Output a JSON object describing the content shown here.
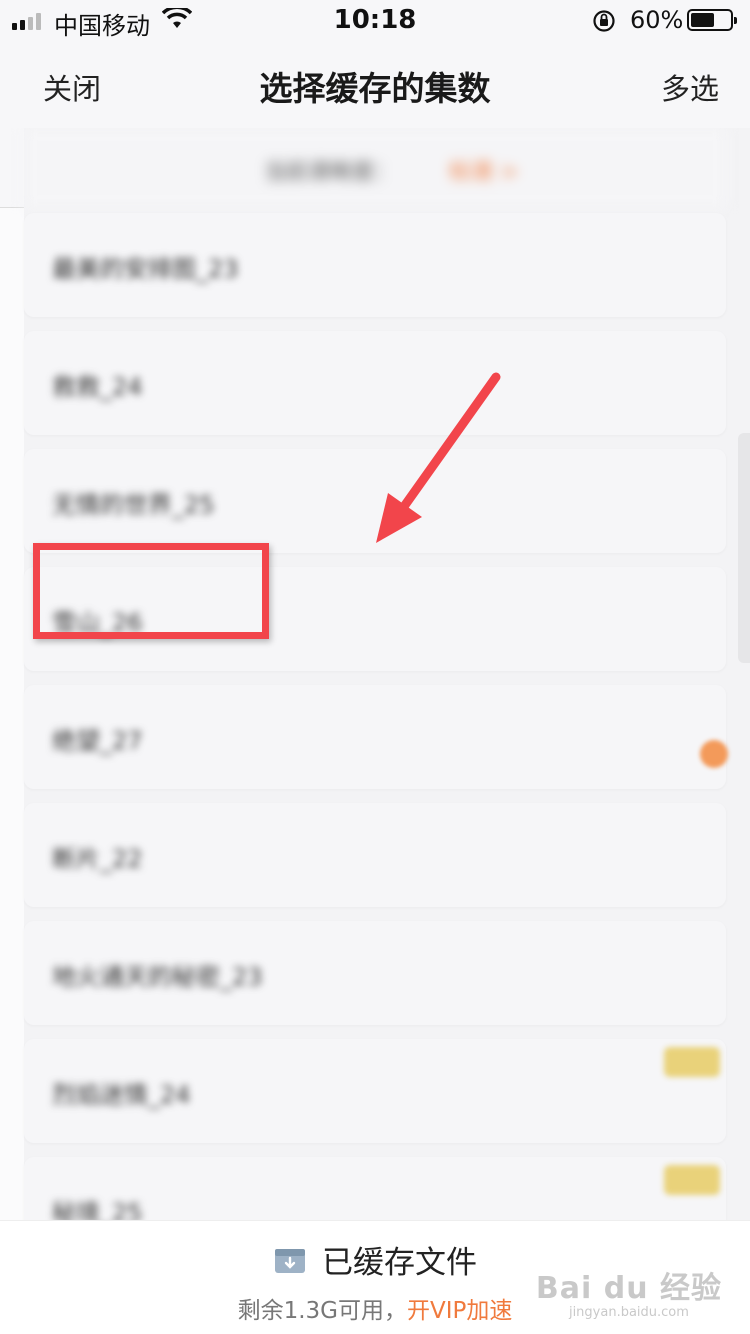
{
  "status_bar": {
    "carrier": "中国移动",
    "time": "10:18",
    "battery_percent": "60%",
    "battery_level": 0.6
  },
  "nav": {
    "close_label": "关闭",
    "title": "选择缓存的集数",
    "multi_select_label": "多选"
  },
  "notice": {
    "text": "当前清晰度：",
    "link": "标清 >"
  },
  "episodes": [
    {
      "label": "最美的安排图_23"
    },
    {
      "label": "救救_24"
    },
    {
      "label": "无情的世界_25"
    },
    {
      "label": "雪山_26"
    },
    {
      "label": "绝望_27"
    },
    {
      "label": "断片_22"
    },
    {
      "label": "地火通天的秘密_23"
    },
    {
      "label": "烈焰迷情_24"
    },
    {
      "label": "秘境_25"
    }
  ],
  "footer": {
    "cached_files_label": "已缓存文件",
    "storage_text": "剩余1.3G可用，",
    "vip_link": "开VIP加速"
  },
  "watermark": {
    "logo": "Bai du 经验",
    "sub": "jingyan.baidu.com"
  },
  "colors": {
    "accent_orange": "#f07a3d",
    "annotation_red": "#f2454b",
    "vip_badge": "#e9d27a"
  }
}
